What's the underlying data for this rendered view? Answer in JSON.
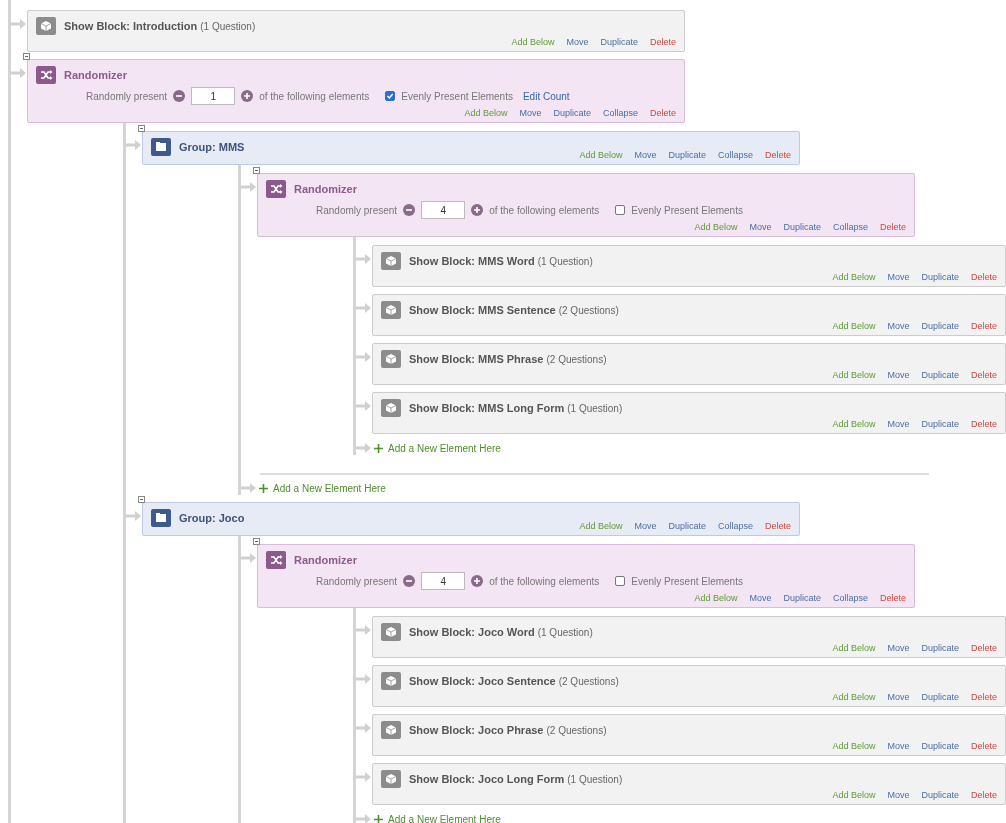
{
  "flow": [
    {
      "kind": "block",
      "title": "Show Block: Introduction",
      "count": "(1 Question)",
      "actions": [
        {
          "label": "Add Below",
          "kind": "add"
        },
        {
          "label": "Move",
          "kind": "move"
        },
        {
          "label": "Duplicate",
          "kind": "duplicate"
        },
        {
          "label": "Delete",
          "kind": "delete"
        }
      ]
    },
    {
      "kind": "randomizer",
      "title": "Randomizer",
      "prefix": "Randomly present",
      "value": "1",
      "suffix": "of the following elements",
      "evenly": {
        "label": "Evenly Present Elements",
        "checked": true
      },
      "edit_count": "Edit Count",
      "actions": [
        {
          "label": "Add Below",
          "kind": "add"
        },
        {
          "label": "Move",
          "kind": "move"
        },
        {
          "label": "Duplicate",
          "kind": "duplicate"
        },
        {
          "label": "Collapse",
          "kind": "collapse"
        },
        {
          "label": "Delete",
          "kind": "delete"
        }
      ],
      "children": [
        {
          "kind": "group",
          "title": "Group: MMS",
          "actions": [
            {
              "label": "Add Below",
              "kind": "add"
            },
            {
              "label": "Move",
              "kind": "move"
            },
            {
              "label": "Duplicate",
              "kind": "duplicate"
            },
            {
              "label": "Collapse",
              "kind": "collapse"
            },
            {
              "label": "Delete",
              "kind": "delete"
            }
          ],
          "add_new": "Add a New Element Here",
          "children": [
            {
              "kind": "randomizer",
              "title": "Randomizer",
              "prefix": "Randomly present",
              "value": "4",
              "suffix": "of the following elements",
              "evenly": {
                "label": "Evenly Present Elements",
                "checked": false
              },
              "actions": [
                {
                  "label": "Add Below",
                  "kind": "add"
                },
                {
                  "label": "Move",
                  "kind": "move"
                },
                {
                  "label": "Duplicate",
                  "kind": "duplicate"
                },
                {
                  "label": "Collapse",
                  "kind": "collapse"
                },
                {
                  "label": "Delete",
                  "kind": "delete"
                }
              ],
              "add_new": "Add a New Element Here",
              "children": [
                {
                  "kind": "block",
                  "title": "Show Block: MMS Word",
                  "count": "(1 Question)",
                  "actions": [
                    {
                      "label": "Add Below",
                      "kind": "add"
                    },
                    {
                      "label": "Move",
                      "kind": "move"
                    },
                    {
                      "label": "Duplicate",
                      "kind": "duplicate"
                    },
                    {
                      "label": "Delete",
                      "kind": "delete"
                    }
                  ]
                },
                {
                  "kind": "block",
                  "title": "Show Block: MMS Sentence",
                  "count": "(2 Questions)",
                  "actions": [
                    {
                      "label": "Add Below",
                      "kind": "add"
                    },
                    {
                      "label": "Move",
                      "kind": "move"
                    },
                    {
                      "label": "Duplicate",
                      "kind": "duplicate"
                    },
                    {
                      "label": "Delete",
                      "kind": "delete"
                    }
                  ]
                },
                {
                  "kind": "block",
                  "title": "Show Block: MMS Phrase",
                  "count": "(2 Questions)",
                  "actions": [
                    {
                      "label": "Add Below",
                      "kind": "add"
                    },
                    {
                      "label": "Move",
                      "kind": "move"
                    },
                    {
                      "label": "Duplicate",
                      "kind": "duplicate"
                    },
                    {
                      "label": "Delete",
                      "kind": "delete"
                    }
                  ]
                },
                {
                  "kind": "block",
                  "title": "Show Block: MMS Long Form",
                  "count": "(1 Question)",
                  "actions": [
                    {
                      "label": "Add Below",
                      "kind": "add"
                    },
                    {
                      "label": "Move",
                      "kind": "move"
                    },
                    {
                      "label": "Duplicate",
                      "kind": "duplicate"
                    },
                    {
                      "label": "Delete",
                      "kind": "delete"
                    }
                  ]
                }
              ]
            }
          ]
        },
        {
          "kind": "group",
          "title": "Group: Joco",
          "actions": [
            {
              "label": "Add Below",
              "kind": "add"
            },
            {
              "label": "Move",
              "kind": "move"
            },
            {
              "label": "Duplicate",
              "kind": "duplicate"
            },
            {
              "label": "Collapse",
              "kind": "collapse"
            },
            {
              "label": "Delete",
              "kind": "delete"
            }
          ],
          "children": [
            {
              "kind": "randomizer",
              "title": "Randomizer",
              "prefix": "Randomly present",
              "value": "4",
              "suffix": "of the following elements",
              "evenly": {
                "label": "Evenly Present Elements",
                "checked": false
              },
              "actions": [
                {
                  "label": "Add Below",
                  "kind": "add"
                },
                {
                  "label": "Move",
                  "kind": "move"
                },
                {
                  "label": "Duplicate",
                  "kind": "duplicate"
                },
                {
                  "label": "Collapse",
                  "kind": "collapse"
                },
                {
                  "label": "Delete",
                  "kind": "delete"
                }
              ],
              "add_new": "Add a New Element Here",
              "children": [
                {
                  "kind": "block",
                  "title": "Show Block: Joco Word",
                  "count": "(1 Question)",
                  "actions": [
                    {
                      "label": "Add Below",
                      "kind": "add"
                    },
                    {
                      "label": "Move",
                      "kind": "move"
                    },
                    {
                      "label": "Duplicate",
                      "kind": "duplicate"
                    },
                    {
                      "label": "Delete",
                      "kind": "delete"
                    }
                  ]
                },
                {
                  "kind": "block",
                  "title": "Show Block: Joco Sentence",
                  "count": "(2 Questions)",
                  "actions": [
                    {
                      "label": "Add Below",
                      "kind": "add"
                    },
                    {
                      "label": "Move",
                      "kind": "move"
                    },
                    {
                      "label": "Duplicate",
                      "kind": "duplicate"
                    },
                    {
                      "label": "Delete",
                      "kind": "delete"
                    }
                  ]
                },
                {
                  "kind": "block",
                  "title": "Show Block: Joco Phrase",
                  "count": "(2 Questions)",
                  "actions": [
                    {
                      "label": "Add Below",
                      "kind": "add"
                    },
                    {
                      "label": "Move",
                      "kind": "move"
                    },
                    {
                      "label": "Duplicate",
                      "kind": "duplicate"
                    },
                    {
                      "label": "Delete",
                      "kind": "delete"
                    }
                  ]
                },
                {
                  "kind": "block",
                  "title": "Show Block: Joco Long Form",
                  "count": "(1 Question)",
                  "actions": [
                    {
                      "label": "Add Below",
                      "kind": "add"
                    },
                    {
                      "label": "Move",
                      "kind": "move"
                    },
                    {
                      "label": "Duplicate",
                      "kind": "duplicate"
                    },
                    {
                      "label": "Delete",
                      "kind": "delete"
                    }
                  ]
                }
              ]
            }
          ]
        }
      ]
    }
  ]
}
